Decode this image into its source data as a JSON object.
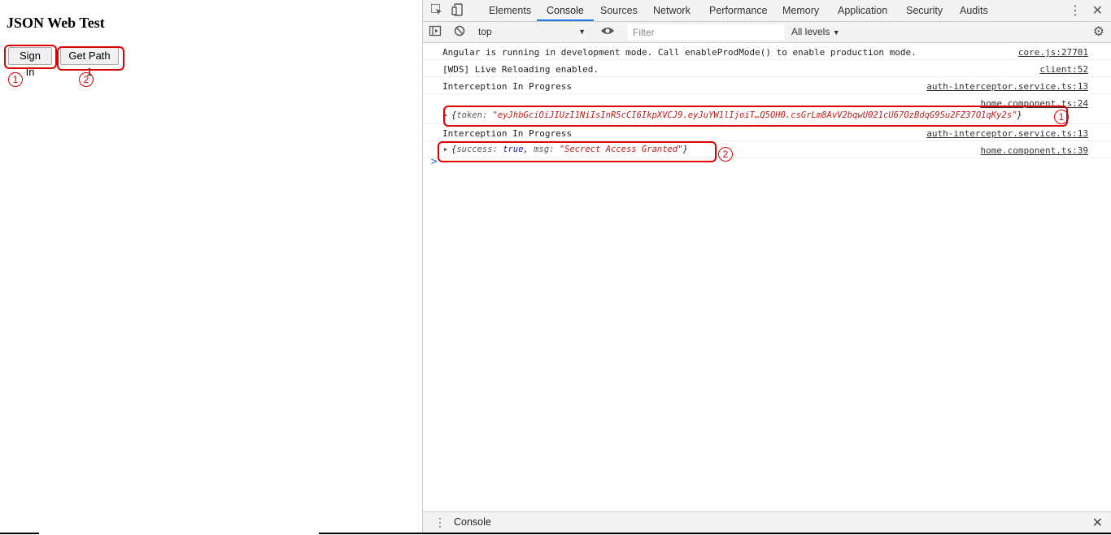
{
  "page": {
    "title": "JSON Web Test",
    "signin_label": "Sign In",
    "getpath_label": "Get Path 1",
    "annotation_1": "1",
    "annotation_2": "2"
  },
  "devtools": {
    "tabs": [
      "Elements",
      "Console",
      "Sources",
      "Network",
      "Performance",
      "Memory",
      "Application",
      "Security",
      "Audits"
    ],
    "active_tab": "Console",
    "context": "top",
    "filter_placeholder": "Filter",
    "levels": "All levels",
    "drawer_tab": "Console",
    "accent_color": "#1a73e8",
    "string_color": "#c41a16"
  },
  "console": {
    "rows": [
      {
        "msg": "Angular is running in development mode. Call enableProdMode() to enable production mode.",
        "src": "core.js:27701"
      },
      {
        "msg": "[WDS] Live Reloading enabled.",
        "src": "client:52"
      },
      {
        "msg": "Interception In Progress",
        "src": "auth-interceptor.service.ts:13"
      },
      {
        "src": "home.component.ts:24",
        "token_key": "token:",
        "token_value": "\"eyJhbGciOiJIUzI1NiIsInR5cCI6IkpXVCJ9.eyJuYW1lIjoiT…Q5OH0.csGrLm8AvV2bqwU021cU67OzBdqG9Su2FZ37O1qKy2s\""
      },
      {
        "msg": "Interception In Progress",
        "src": "auth-interceptor.service.ts:13"
      },
      {
        "src": "home.component.ts:39",
        "success_key": "success:",
        "success_value": "true",
        "msg_key": "msg:",
        "msg_value": "\"Secrect Access Granted\""
      }
    ],
    "annotation_1": "1",
    "annotation_2": "2",
    "prompt": ">"
  }
}
